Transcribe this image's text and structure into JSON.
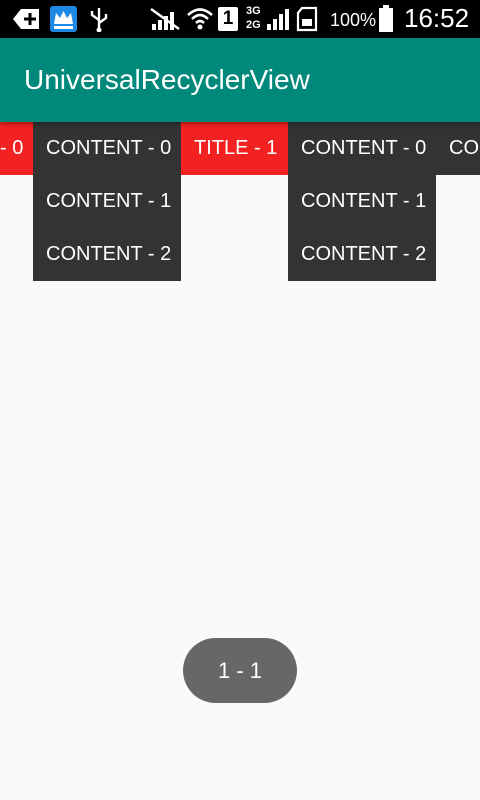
{
  "status_bar": {
    "battery_percent": "100%",
    "time": "16:52",
    "sim_slot": "1",
    "network_top": "3G",
    "network_bottom": "2G",
    "icons": [
      "back-plus-icon",
      "crown-app-icon",
      "usb-icon",
      "no-signal-icon",
      "wifi-icon",
      "sim-1-icon",
      "signal-icon",
      "sd-card-icon",
      "battery-icon"
    ]
  },
  "app_bar": {
    "title": "UniversalRecyclerView"
  },
  "list": {
    "cells": [
      {
        "kind": "title",
        "text": "- 0"
      },
      {
        "kind": "content",
        "text": "CONTENT - 0"
      },
      {
        "kind": "content",
        "text": "CONTENT - 1"
      },
      {
        "kind": "content",
        "text": "CONTENT - 2"
      },
      {
        "kind": "title",
        "text": "TITLE - 1"
      },
      {
        "kind": "content",
        "text": "CONTENT - 0"
      },
      {
        "kind": "content",
        "text": "CONTENT - 1"
      },
      {
        "kind": "content",
        "text": "CONTENT - 2"
      },
      {
        "kind": "content",
        "text": "CON"
      }
    ],
    "colors": {
      "title": "#f22222",
      "content": "#333333"
    }
  },
  "indicator": {
    "text": "1 - 1"
  },
  "colors": {
    "app_bar": "#00897b",
    "status_bar": "#000000",
    "background": "#fafafa"
  }
}
